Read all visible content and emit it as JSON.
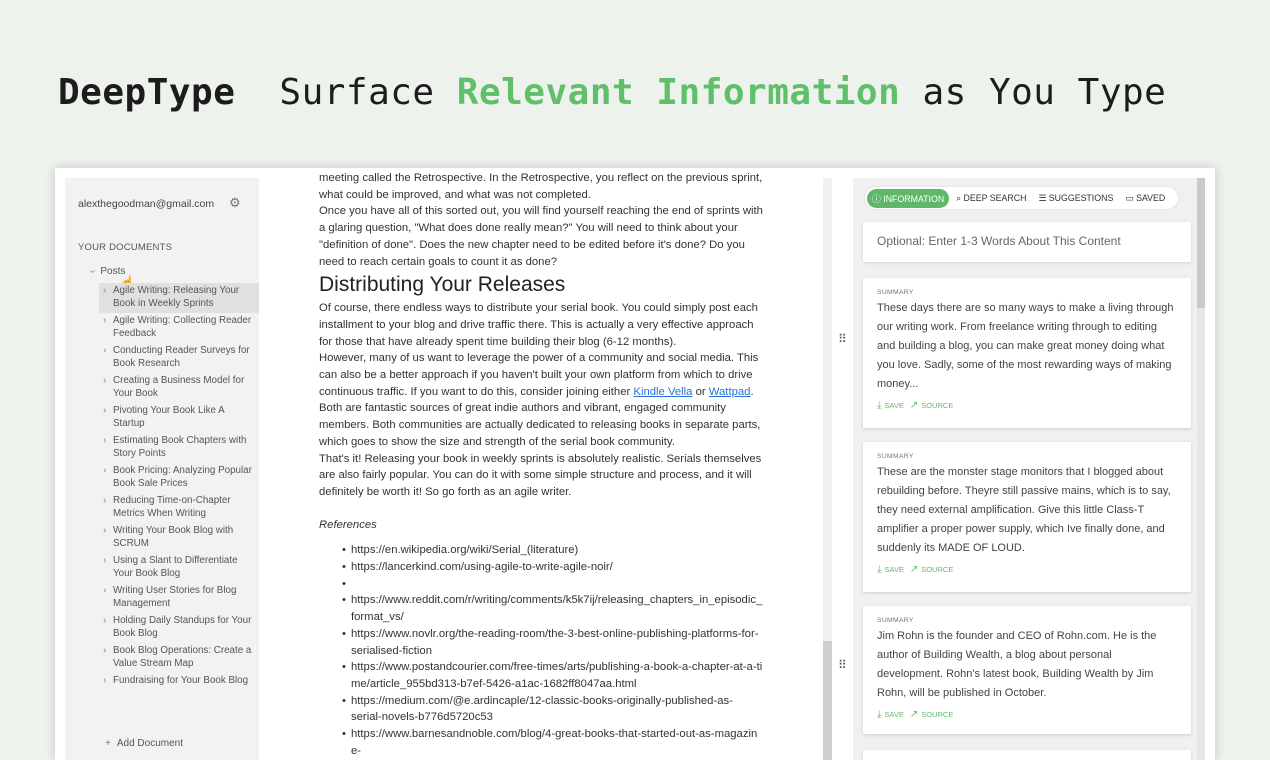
{
  "header": {
    "brand": "DeepType",
    "tagline_pre": "Surface ",
    "tagline_accent": "Relevant Information",
    "tagline_post": " as You Type"
  },
  "sidebar": {
    "account": "alexthegoodman@gmail.com",
    "section_title": "YOUR DOCUMENTS",
    "folder": "Posts",
    "documents": [
      "Agile Writing: Releasing Your Book in Weekly Sprints",
      "Agile Writing: Collecting Reader Feedback",
      "Conducting Reader Surveys for Book Research",
      "Creating a Business Model for Your Book",
      "Pivoting Your Book Like A Startup",
      "Estimating Book Chapters with Story Points",
      "Book Pricing: Analyzing Popular Book Sale Prices",
      "Reducing Time-on-Chapter Metrics When Writing",
      "Writing Your Book Blog with SCRUM",
      "Using a Slant to Differentiate Your Book Blog",
      "Writing User Stories for Blog Management",
      "Holding Daily Standups for Your Book Blog",
      "Book Blog Operations: Create a Value Stream Map",
      "Fundraising for Your Book Blog"
    ],
    "add_document": "Add Document"
  },
  "editor": {
    "p0": "meeting called the Retrospective. In the Retrospective, you reflect on the previous sprint, what could be improved, and what was not completed.",
    "p1": "Once you have all of this sorted out, you will find yourself reaching the end of sprints with a glaring question, \"What does done really mean?\" You will need to think about your \"definition of done\". Does the new chapter need to be edited before it's done? Do you need to reach certain goals to count it as done?",
    "h2": "Distributing Your Releases",
    "p2": "Of course, there endless ways to distribute your serial book. You could simply post each installment to your blog and drive traffic there. This is actually a very effective approach for those that have already spent time building their blog (6-12 months).",
    "p3a": "However, many of us want to leverage the power of a community and social media. This can also be a better approach if you haven't built your own platform from which to drive continuous traffic. If you want to do this, consider joining either ",
    "link1": "Kindle Vella",
    "p3b": " or ",
    "link2": "Wattpad",
    "p3c": ". Both are fantastic sources of great indie authors and vibrant, engaged community members. Both communities are actually dedicated to releasing books in separate parts, which goes to show the size and strength of the serial book community.",
    "p4": "That's it! Releasing your book in weekly sprints is absolutely realistic. Serials themselves are also fairly popular. You can do it with some simple structure and process, and it will definitely be worth it! So go forth as an agile writer.",
    "refs_title": "References",
    "refs": [
      "https://en.wikipedia.org/wiki/Serial_(literature)",
      "https://lancerkind.com/using-agile-to-write-agile-noir/",
      "",
      "https://www.reddit.com/r/writing/comments/k5k7ij/releasing_chapters_in_episodic_format_vs/",
      "https://www.novlr.org/the-reading-room/the-3-best-online-publishing-platforms-for-serialised-fiction",
      "https://www.postandcourier.com/free-times/arts/publishing-a-book-a-chapter-at-a-time/article_955bd313-b7ef-5426-a1ac-1682ff8047aa.html",
      "https://medium.com/@e.ardincaple/12-classic-books-originally-published-as-serial-novels-b776d5720c53",
      "https://www.barnesandnoble.com/blog/4-great-books-that-started-out-as-magazine-"
    ]
  },
  "panel": {
    "tabs": [
      "INFORMATION",
      "DEEP SEARCH",
      "SUGGESTIONS",
      "SAVED"
    ],
    "query_placeholder": "Optional: Enter 1-3 Words About This Content",
    "cards": [
      {
        "label": "SUMMARY",
        "text": "These days there are so many ways to make a living through our writing work. From freelance writing through to editing and building a blog, you can make great money doing what you love. Sadly, some of the most rewarding ways of making money...",
        "save": "SAVE",
        "source": "SOURCE"
      },
      {
        "label": "SUMMARY",
        "text": "These are the monster stage monitors that I blogged about rebuilding before. Theyre still passive mains, which is to say, they need external amplification. Give this little Class-T amplifier a proper power supply, which Ive finally done, and suddenly its MADE OF LOUD.",
        "save": "SAVE",
        "source": "SOURCE"
      },
      {
        "label": "SUMMARY",
        "text": "Jim Rohn is the founder and CEO of Rohn.com. He is the author of Building Wealth, a blog about personal development. Rohn's latest book, Building Wealth by Jim Rohn, will be published in October.",
        "save": "SAVE",
        "source": "SOURCE"
      }
    ]
  }
}
